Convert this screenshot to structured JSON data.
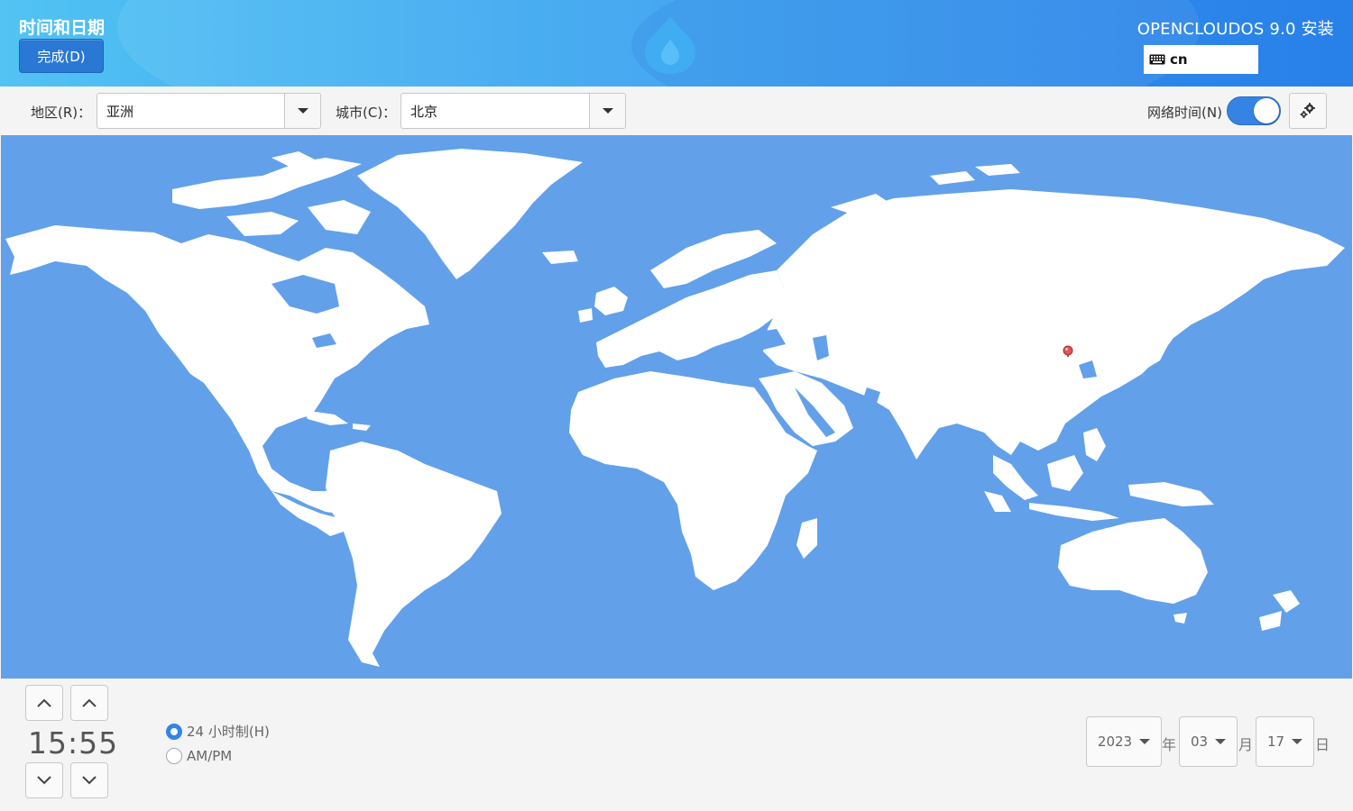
{
  "header": {
    "title": "时间和日期",
    "done_label": "完成(D)",
    "product": "OPENCLOUDOS 9.0 安装",
    "keyboard_layout": "cn"
  },
  "toolbar": {
    "region_label": "地区(R)：",
    "region_value": "亚洲",
    "city_label": "城市(C)：",
    "city_value": "北京",
    "network_time_label": "网络时间(N)",
    "network_time_enabled": true
  },
  "map": {
    "selected_city": "北京",
    "ocean_color": "#62a0ea",
    "land_color": "#ffffff",
    "pin_color": "#e05555"
  },
  "time": {
    "value": "15:55",
    "format_24h_label": "24 小时制(H)",
    "format_ampm_label": "AM/PM",
    "selected_format": "24h"
  },
  "date": {
    "year": "2023",
    "year_unit": "年",
    "month": "03",
    "month_unit": "月",
    "day": "17",
    "day_unit": "日"
  },
  "colors": {
    "accent": "#3584e4",
    "header_start": "#52c3f3",
    "header_end": "#2b86ee"
  },
  "icons": [
    "keyboard-icon",
    "gear-icon",
    "chevron-up-icon",
    "chevron-down-icon",
    "location-pin-icon",
    "dropdown-arrow-icon"
  ]
}
